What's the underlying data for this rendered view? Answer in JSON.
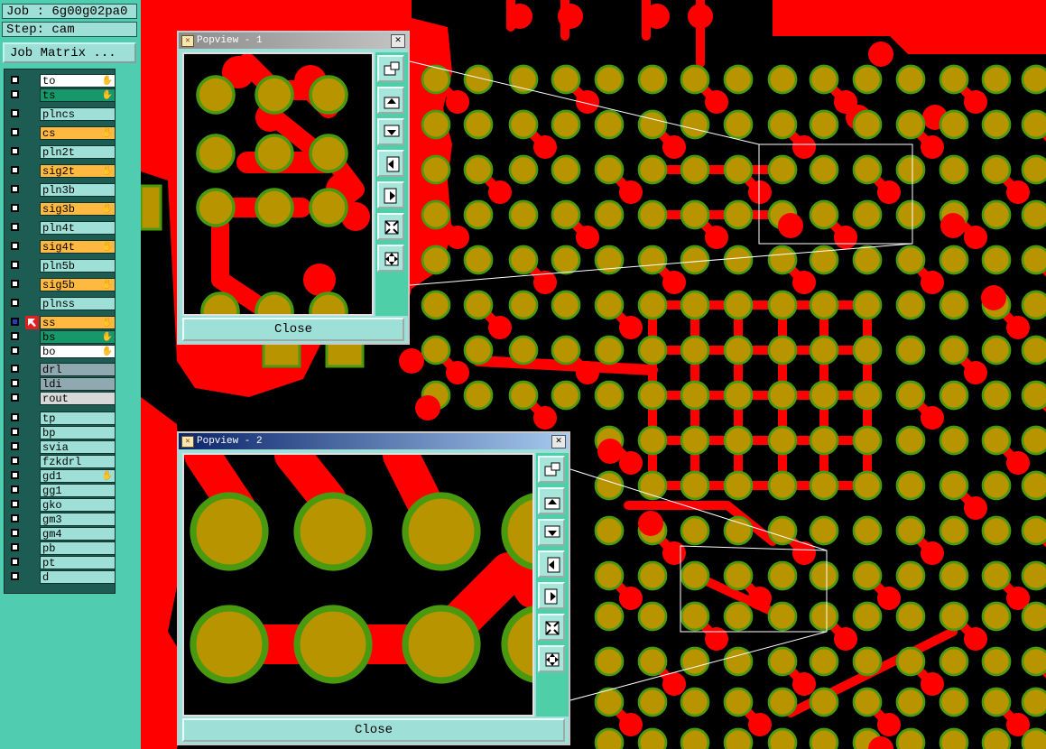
{
  "job_label": "Job : 6g00g02pa0",
  "step_label": "Step: cam",
  "job_matrix_button": "Job Matrix ...",
  "colors": {
    "copper": "#ff0000",
    "pad": "#b89400",
    "pad_ring": "#4a9a10",
    "panel": "#50cdb0",
    "button": "#9ee0d8"
  },
  "layers": [
    {
      "name": "to",
      "bg": "#ffffff",
      "mark": "hand-icon"
    },
    {
      "name": "ts",
      "bg": "#16986a",
      "mark": "hand-icon"
    },
    {
      "name": "plncs",
      "bg": "#9ee0d8",
      "mark": ""
    },
    {
      "name": "cs",
      "bg": "#ffb840",
      "mark": "hand-icon"
    },
    {
      "name": "pln2t",
      "bg": "#9ee0d8",
      "mark": ""
    },
    {
      "name": "sig2t",
      "bg": "#ffb840",
      "mark": "hand-icon"
    },
    {
      "name": "pln3b",
      "bg": "#9ee0d8",
      "mark": ""
    },
    {
      "name": "sig3b",
      "bg": "#ffb840",
      "mark": "hand-icon"
    },
    {
      "name": "pln4t",
      "bg": "#9ee0d8",
      "mark": ""
    },
    {
      "name": "sig4t",
      "bg": "#ffb840",
      "mark": "hand-icon"
    },
    {
      "name": "pln5b",
      "bg": "#9ee0d8",
      "mark": ""
    },
    {
      "name": "sig5b",
      "bg": "#ffb840",
      "mark": "hand-icon"
    },
    {
      "name": "plnss",
      "bg": "#9ee0d8",
      "mark": ""
    },
    {
      "name": "ss",
      "bg": "#ffb840",
      "mark": "hand-icon",
      "active": true
    },
    {
      "name": "bs",
      "bg": "#16986a",
      "mark": "hand-icon"
    },
    {
      "name": "bo",
      "bg": "#ffffff",
      "mark": "hand-icon"
    },
    {
      "name": "drl",
      "bg": "#90a8b0",
      "mark": ""
    },
    {
      "name": "ldi",
      "bg": "#90a8b0",
      "mark": ""
    },
    {
      "name": "rout",
      "bg": "#d8d8d8",
      "mark": ""
    },
    {
      "name": "tp",
      "bg": "#9ee0d8",
      "mark": ""
    },
    {
      "name": "bp",
      "bg": "#9ee0d8",
      "mark": ""
    },
    {
      "name": "svia",
      "bg": "#9ee0d8",
      "mark": ""
    },
    {
      "name": "fzkdrl",
      "bg": "#9ee0d8",
      "mark": ""
    },
    {
      "name": "gd1",
      "bg": "#9ee0d8",
      "mark": "hand-icon"
    },
    {
      "name": "gg1",
      "bg": "#9ee0d8",
      "mark": ""
    },
    {
      "name": "gko",
      "bg": "#9ee0d8",
      "mark": ""
    },
    {
      "name": "gm3",
      "bg": "#9ee0d8",
      "mark": ""
    },
    {
      "name": "gm4",
      "bg": "#9ee0d8",
      "mark": ""
    },
    {
      "name": "pb",
      "bg": "#9ee0d8",
      "mark": ""
    },
    {
      "name": "pt",
      "bg": "#9ee0d8",
      "mark": ""
    },
    {
      "name": "d",
      "bg": "#9ee0d8",
      "mark": ""
    }
  ],
  "popview1": {
    "title": "Popview - 1",
    "close_label": "Close"
  },
  "popview2": {
    "title": "Popview - 2",
    "close_label": "Close"
  },
  "toolbar_icons": [
    "zoom-home-icon",
    "pan-up-icon",
    "pan-down-icon",
    "pan-left-icon",
    "pan-right-icon",
    "zoom-out-icon",
    "zoom-fit-icon"
  ]
}
